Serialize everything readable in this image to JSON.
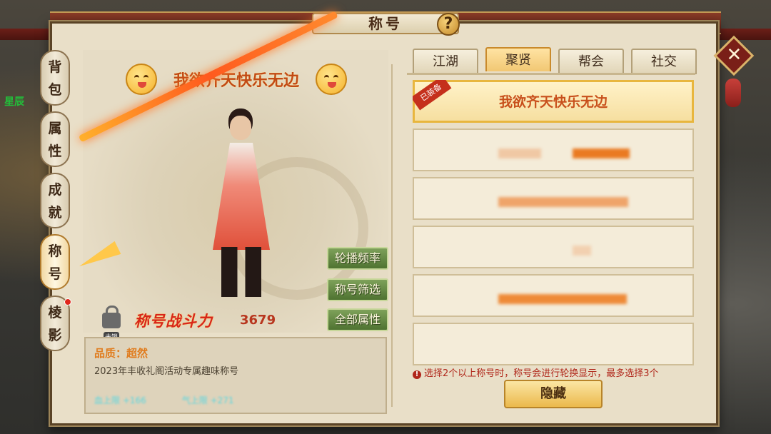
{
  "window": {
    "title": "称号"
  },
  "side_tabs": [
    {
      "label_top": "背",
      "label_bottom": "包"
    },
    {
      "label_top": "属",
      "label_bottom": "性"
    },
    {
      "label_top": "成",
      "label_bottom": "就"
    },
    {
      "label_top": "称",
      "label_bottom": "号"
    },
    {
      "label_top": "棱",
      "label_bottom": "影"
    }
  ],
  "character": {
    "title": "我欲齐天快乐无边",
    "lock_label": "未锁",
    "power_label": "称号战斗力",
    "power_value": "3679"
  },
  "actions": {
    "rotate_freq": "轮播频率",
    "filter": "称号筛选",
    "all_attrs": "全部属性"
  },
  "info": {
    "quality": "品质：超然",
    "description": "2023年丰收礼阁活动专属趣味称号",
    "stat1": "血上限 +166",
    "stat2": "气上限 +271"
  },
  "tabs": [
    "江湖",
    "聚贤",
    "帮会",
    "社交"
  ],
  "list": {
    "equipped_badge": "已装备",
    "equipped_title": "我欲齐天快乐无边"
  },
  "notice": "选择2个以上称号时，称号会进行轮换显示，最多选择3个",
  "hide_button": "隐藏",
  "scene": {
    "left_text": "星辰"
  },
  "colors": {
    "accent": "#c8501c",
    "panel": "#e9dfc8",
    "button_green": "#5f8240"
  }
}
